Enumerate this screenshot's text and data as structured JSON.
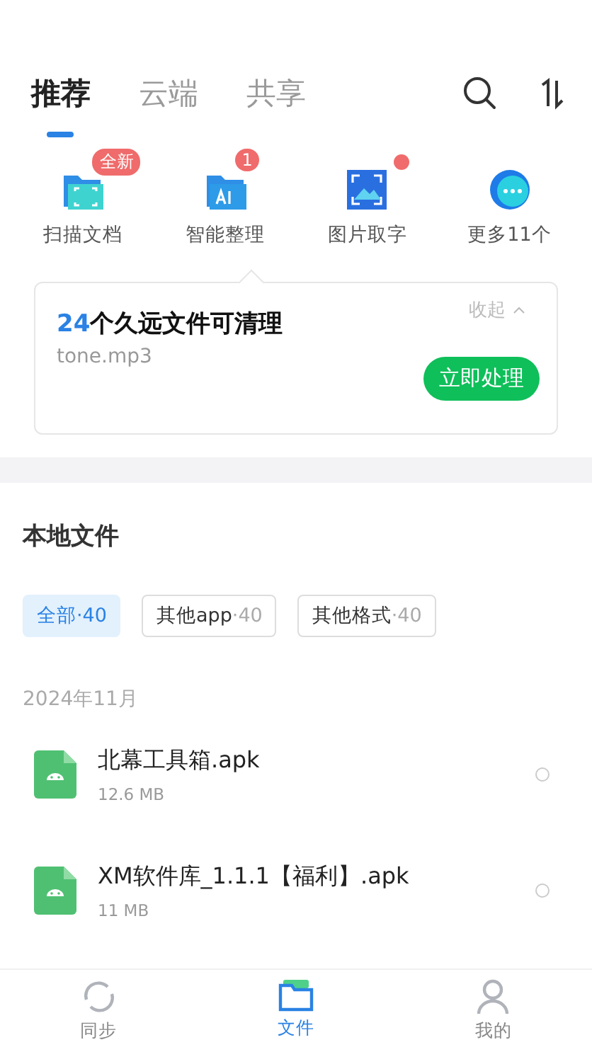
{
  "tabs": [
    {
      "label": "推荐",
      "selected": true
    },
    {
      "label": "云端",
      "selected": false
    },
    {
      "label": "共享",
      "selected": false
    }
  ],
  "tools": [
    {
      "kind": "scan",
      "label": "扫描文档",
      "badge": {
        "kind": "text",
        "text": "全新"
      }
    },
    {
      "kind": "ai",
      "label": "智能整理",
      "badge": {
        "kind": "text",
        "text": "1"
      }
    },
    {
      "kind": "image",
      "label": "图片取字",
      "badge": {
        "kind": "dot"
      }
    },
    {
      "kind": "more",
      "label": "更多11个"
    }
  ],
  "cleanup_card": {
    "count": "24",
    "title": "个久远文件可清理",
    "collapse": "收起",
    "file": "tone.mp3",
    "action": "立即处理"
  },
  "local_files": {
    "title": "本地文件",
    "filters": [
      {
        "label": "全部",
        "count": "·40",
        "selected": true
      },
      {
        "label": "其他app",
        "count": "·40",
        "selected": false
      },
      {
        "label": "其他格式",
        "count": "·40",
        "selected": false
      }
    ],
    "date": "2024年11月",
    "files": [
      {
        "name": "北幕工具箱.apk",
        "size": "12.6 MB",
        "checked": false
      },
      {
        "name": "XM软件库_1.1.1【福利】.apk",
        "size": "11 MB",
        "checked": false
      }
    ]
  },
  "bottom_nav": [
    {
      "kind": "sync",
      "label": "同步",
      "selected": false
    },
    {
      "kind": "files",
      "label": "文件",
      "selected": true
    },
    {
      "kind": "me",
      "label": "我的",
      "selected": false
    }
  ]
}
